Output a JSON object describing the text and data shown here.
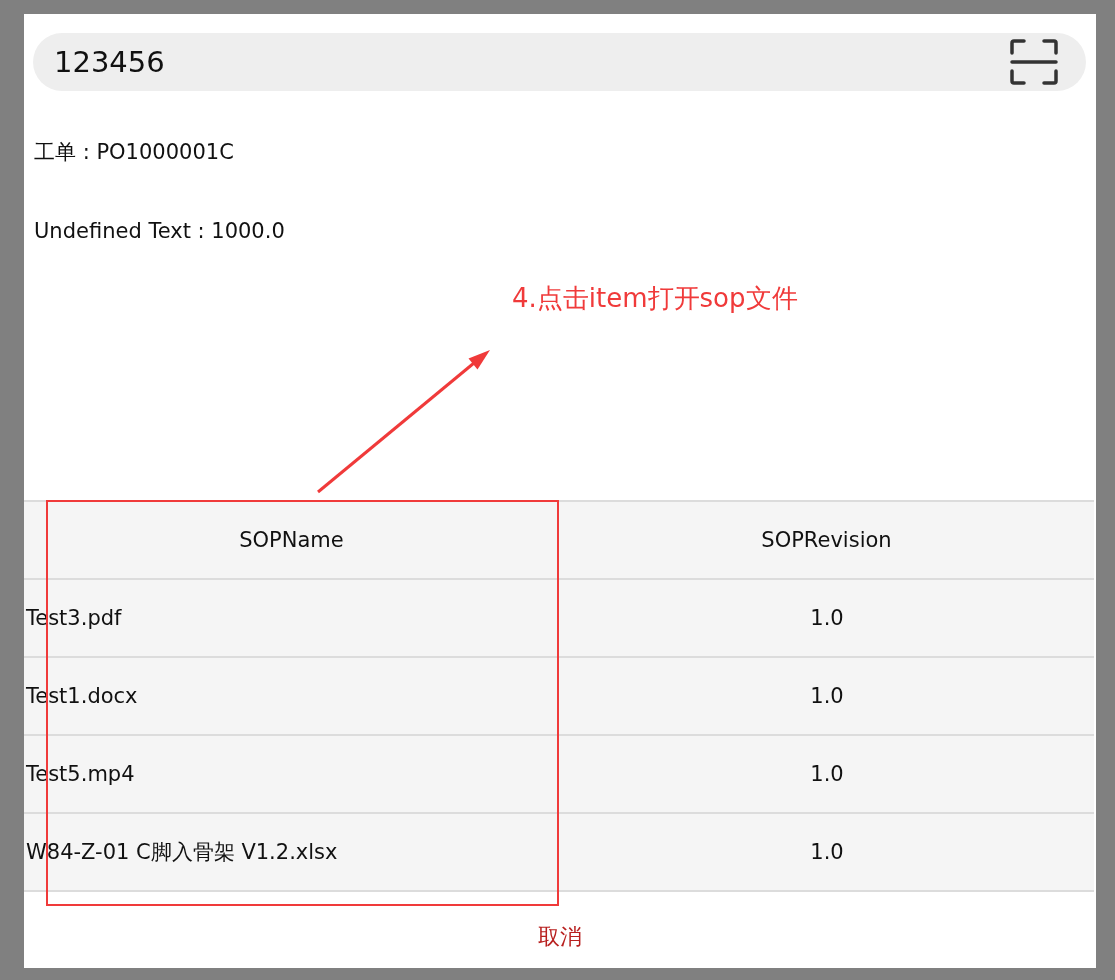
{
  "search": {
    "value": "123456"
  },
  "fields": [
    "工单 : PO1000001C",
    "Undefined Text : 1000.0"
  ],
  "annotation": {
    "text": "4.点击item打开sop文件"
  },
  "table": {
    "columns": [
      "SOPName",
      "SOPRevision"
    ],
    "rows": [
      [
        "Test3.pdf",
        "1.0"
      ],
      [
        "Test1.docx",
        "1.0"
      ],
      [
        "Test5.mp4",
        "1.0"
      ],
      [
        "W84-Z-01 C脚入骨架 V1.2.xlsx",
        "1.0"
      ]
    ]
  },
  "cancel_button": "取消"
}
